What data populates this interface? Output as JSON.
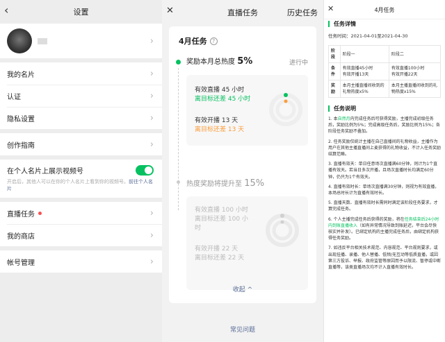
{
  "settings": {
    "title": "设置",
    "items": {
      "card": "我的名片",
      "auth": "认证",
      "privacy": "隐私设置",
      "guide": "创作指南",
      "show_channels": "在个人名片上展示视频号",
      "hint_text": "开启后，其他人可以在你的个人名片上看到你的视频号。",
      "hint_link": "前往个人名片",
      "live_task": "直播任务",
      "shop": "我的商店",
      "account": "帐号管理"
    },
    "toggle_on": true
  },
  "live_task": {
    "nav_title": "直播任务",
    "history": "历史任务",
    "month_title": "4月任务",
    "help_icon": "?",
    "stage1": {
      "title_prefix": "奖励本月总热度",
      "percent": "5%",
      "status": "进行中",
      "metric1": "有效直播 45 小时",
      "metric1_diff": "离目标还差 45 小时",
      "metric2": "有效开播 13 天",
      "metric2_diff": "离目标还差 13 天"
    },
    "stage2": {
      "title_prefix": "热度奖励将提升至",
      "percent": "15%",
      "metric1": "有效直播 100 小时",
      "metric1_diff": "离目标还差 100 小时",
      "metric2": "有效开播 22 天",
      "metric2_diff": "离目标还差 22 天"
    },
    "collapse": "收起 ^",
    "faq": "常见问题"
  },
  "details": {
    "nav_title": "4月任务",
    "section1": "任务详情",
    "time": "任务时间：2021-04-01至2021-04-30",
    "table": {
      "header": [
        "阶段",
        "阶段一",
        "阶段二"
      ],
      "row1_head": "条件",
      "row1": [
        "有效直播45小时",
        "有效开播13天",
        "有效直播100小时",
        "有效开播22天"
      ],
      "row2_head": "奖励",
      "row2": [
        "本月主播直播间收到的礼物热度x5%",
        "本月主播直播间收到的礼物热度x15%"
      ]
    },
    "section2": "任务说明",
    "rule1a": "1. 本",
    "rule1b": "自然月",
    "rule1c": "内完成任务后可获得奖励，主播完成初级任务后，奖励比例为5%；完成高级任务后，奖励比例为15%；各阶段任务奖励不叠加。",
    "rule2": "2. 任务奖励仅统计主播在自己直播间的礼物收益，主播作为用户在其他主播直播间上麦获得的礼物收益，不计入任务奖励结算范畴。",
    "rule3": "3. 直播有效天：单日任意场次直播满60分钟，则计为1个直播有效天。若当日多次开播，且场次直播时长均满足60分钟，仍只为1个有效天。",
    "rule4": "4. 直播有效时长：单场次直播满30分钟，则视为有效直播，本场总时长计为直播有效时长。",
    "rule5": "5. 直播天数、直播有效时长需同时满足该阶段任务要求，才算完成任务。",
    "rule6a": "6. 个人主播完成任务后获得的奖励，将在",
    "rule6b": "任务结束后24小时内到账直播收入",
    "rule6c": "（如有异常情况导致到账延迟，平台会尽快核实并补发）。已绑定机构的主播完成任务后，由绑定机构获得任务奖励。",
    "rule7": "7. 如违反平台相关技术规范、内容规范、平台规则要求，或出现挂播、录播、他人替播、低频/无互动等低质直播，或因第三方投诉、举报、政府监管等原因而予以限流、暂停或中断直播等，该类直播场次均不计入直播有效时长。"
  },
  "colors": {
    "accent_green": "#07c160",
    "accent_yellow": "#fa9d3b",
    "link_blue": "#576b95",
    "badge_red": "#fa5151"
  }
}
